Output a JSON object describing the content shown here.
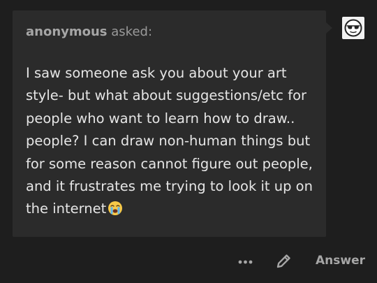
{
  "ask": {
    "asker": "anonymous",
    "asked_label": "asked:",
    "question": "I saw someone ask you about your art style- but what about suggestions/etc for people who want to learn how to draw.. people? I can draw non-human things but for some reason cannot figure out people, and it frustrates me trying to look it up on the internet",
    "emoji_icon": "loudly-crying-face-emoji"
  },
  "avatar": {
    "icon": "sunglasses-face-icon"
  },
  "actions": {
    "more_icon": "ellipsis-icon",
    "edit_icon": "pencil-icon",
    "answer_label": "Answer"
  },
  "colors": {
    "page_background": "#1e1e1e",
    "card_background": "#2b2b2b",
    "body_text": "#e6e6e6",
    "muted_text": "#a6a6a6"
  }
}
